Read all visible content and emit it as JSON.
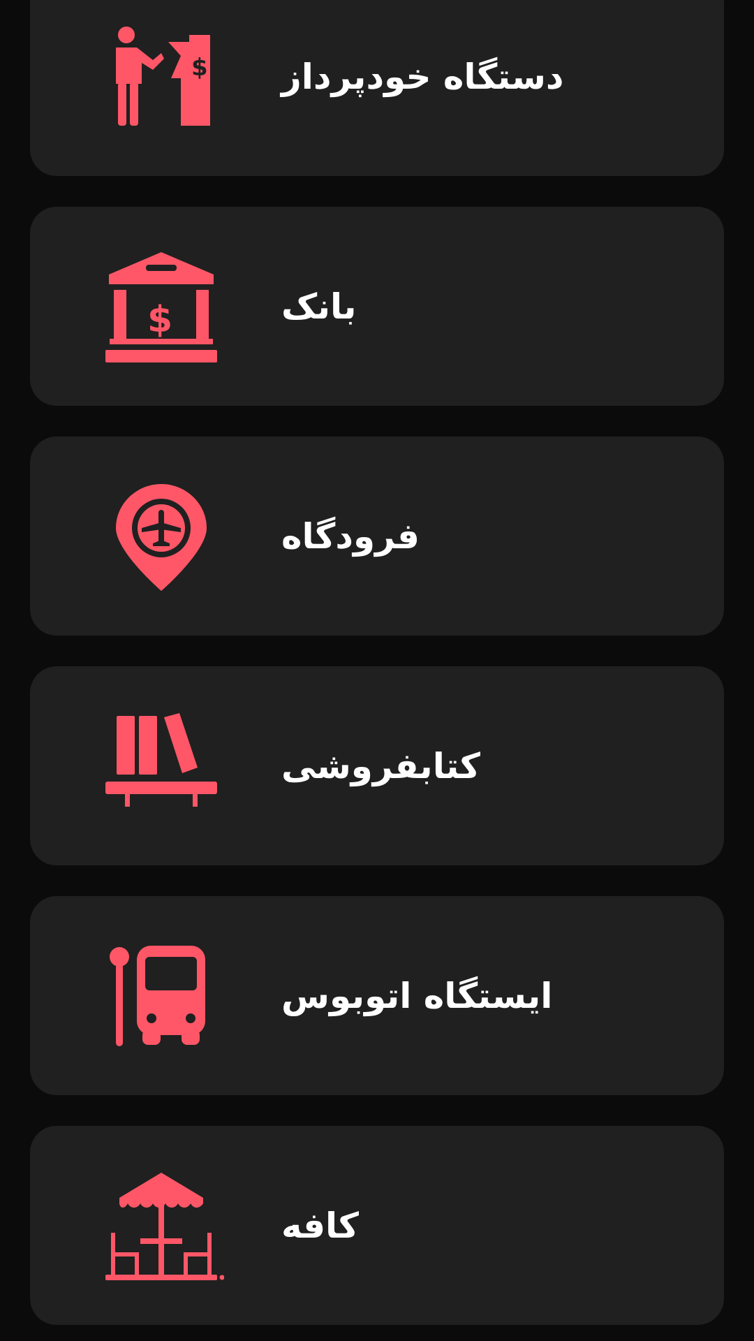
{
  "theme": {
    "background": "#0b0b0b",
    "card_background": "#202020",
    "accent": "#ff5767",
    "text": "#ffffff"
  },
  "categories": [
    {
      "label": "دستگاه خودپرداز",
      "icon": "atm-icon"
    },
    {
      "label": "بانک",
      "icon": "bank-icon"
    },
    {
      "label": "فرودگاه",
      "icon": "airport-icon"
    },
    {
      "label": "کتابفروشی",
      "icon": "bookstore-icon"
    },
    {
      "label": "ایستگاه اتوبوس",
      "icon": "bus-stop-icon"
    },
    {
      "label": "کافه",
      "icon": "cafe-icon"
    }
  ]
}
